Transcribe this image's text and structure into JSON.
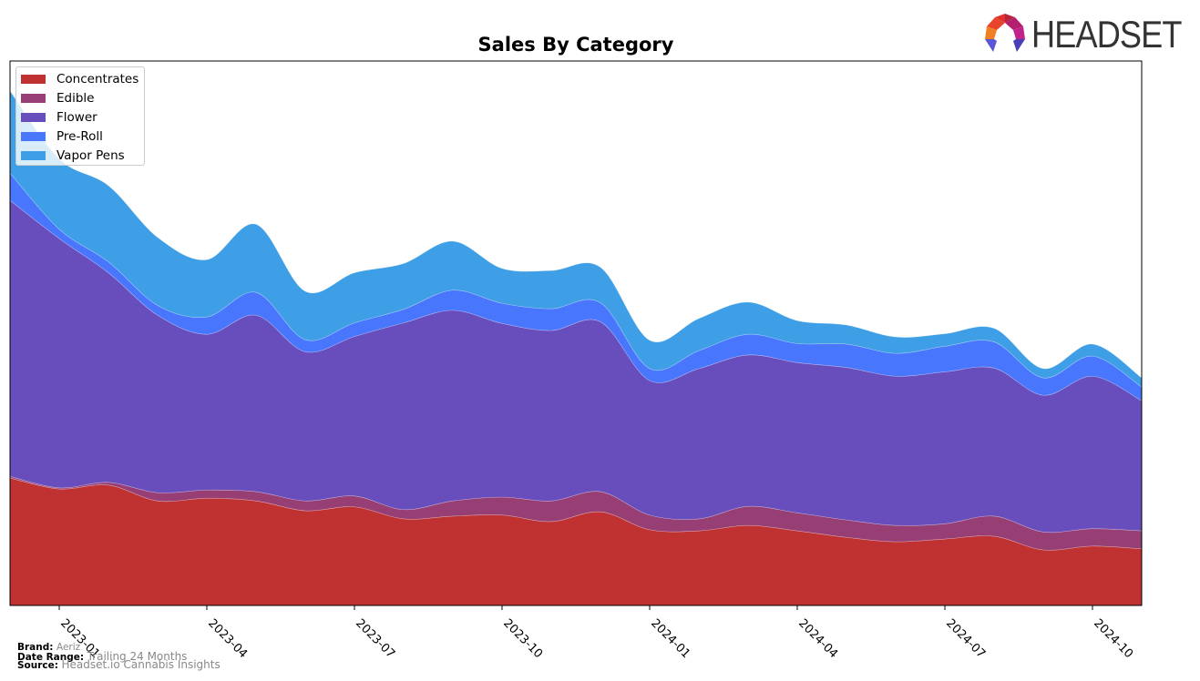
{
  "header": {
    "logo_text": "HEADSET",
    "logo_icon": "headset-hexagon-logo-icon"
  },
  "chart_data": {
    "type": "area",
    "stacked": true,
    "smoothed": true,
    "title": "Sales By Category",
    "xlabel": "",
    "ylabel": "",
    "y_tick_labels_shown": false,
    "y_units": "relative (percent of axis range, axis top = 100)",
    "ylim": [
      0,
      100
    ],
    "grid": false,
    "legend_position": "top-left",
    "x": [
      "2022-12",
      "2023-01",
      "2023-02",
      "2023-03",
      "2023-04",
      "2023-05",
      "2023-06",
      "2023-07",
      "2023-08",
      "2023-09",
      "2023-10",
      "2023-11",
      "2023-12",
      "2024-01",
      "2024-02",
      "2024-03",
      "2024-04",
      "2024-05",
      "2024-06",
      "2024-07",
      "2024-08",
      "2024-09",
      "2024-10",
      "2024-11"
    ],
    "x_tick_labels": [
      "2023-01",
      "2023-04",
      "2023-07",
      "2023-10",
      "2024-01",
      "2024-04",
      "2024-07",
      "2024-10"
    ],
    "series": [
      {
        "name": "Concentrates",
        "color": "#c03232",
        "values": [
          23.4,
          21.4,
          22.1,
          19.2,
          19.7,
          19.2,
          17.4,
          18.1,
          15.9,
          16.4,
          16.6,
          15.4,
          17.2,
          13.9,
          13.7,
          14.7,
          13.7,
          12.5,
          11.7,
          12.2,
          12.7,
          10.2,
          10.9,
          10.4
        ]
      },
      {
        "name": "Edible",
        "color": "#973f75",
        "values": [
          0.3,
          0.2,
          0.5,
          1.5,
          1.5,
          1.7,
          1.8,
          2.0,
          1.7,
          2.8,
          3.3,
          3.8,
          3.7,
          2.7,
          2.2,
          3.5,
          3.3,
          3.2,
          3.0,
          2.8,
          3.7,
          3.3,
          3.2,
          3.3
        ]
      },
      {
        "name": "Flower",
        "color": "#684dbc",
        "values": [
          50.7,
          45.8,
          38.5,
          32.6,
          28.6,
          32.4,
          27.4,
          29.3,
          34.3,
          35.0,
          31.9,
          31.3,
          31.2,
          24.7,
          27.6,
          27.8,
          27.6,
          28.0,
          27.4,
          27.9,
          27.2,
          25.1,
          28.0,
          23.9
        ]
      },
      {
        "name": "Pre-Roll",
        "color": "#4876fc",
        "values": [
          5.0,
          1.7,
          2.0,
          1.8,
          3.2,
          4.2,
          2.2,
          2.5,
          2.5,
          3.7,
          3.7,
          4.0,
          3.5,
          2.2,
          3.3,
          3.8,
          3.5,
          4.3,
          4.2,
          4.7,
          4.8,
          3.2,
          3.7,
          2.5
        ]
      },
      {
        "name": "Vapor Pens",
        "color": "#3e9fe6",
        "values": [
          15.1,
          12.9,
          14.0,
          12.5,
          10.5,
          12.5,
          8.9,
          9.2,
          8.4,
          9.0,
          6.4,
          7.0,
          6.5,
          5.2,
          5.9,
          5.9,
          4.2,
          3.5,
          3.0,
          2.3,
          2.5,
          1.7,
          2.2,
          1.7
        ]
      }
    ]
  },
  "footer": {
    "brand_label": "Brand:",
    "brand_value": "Aeriz",
    "date_range_label": "Date Range:",
    "date_range_value": "Trailing 24 Months",
    "source_label": "Source:",
    "source_value": "Headset.io Cannabis Insights"
  }
}
